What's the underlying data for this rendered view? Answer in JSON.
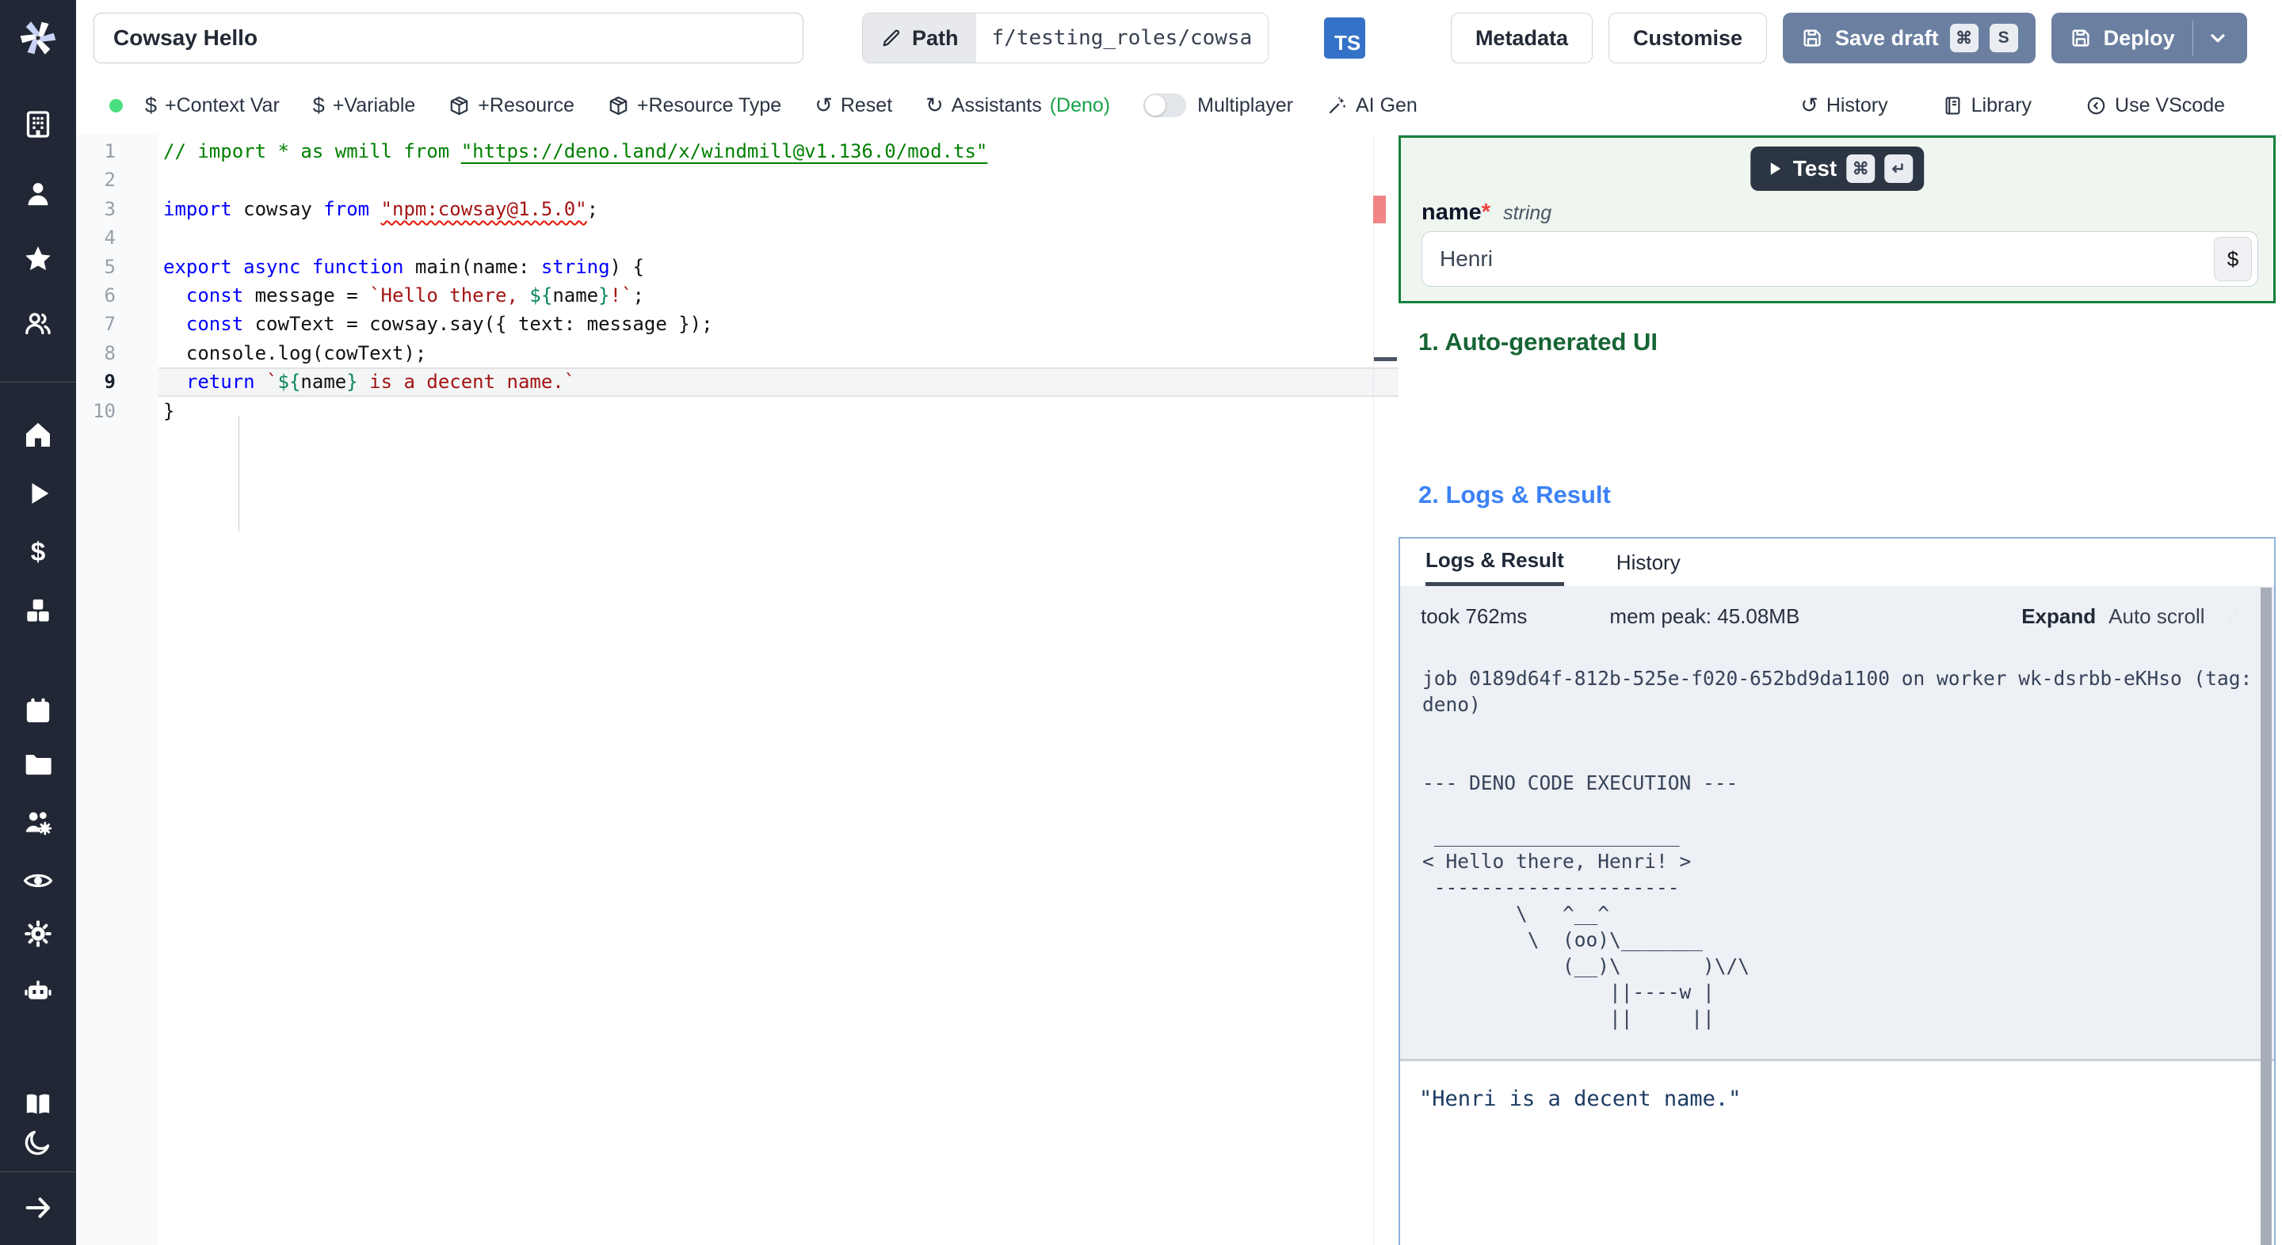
{
  "colors": {
    "sidebar_bg": "#212734",
    "accent_button": "#6b80a1",
    "ts_badge": "#3472c7",
    "status_dot": "#4ade80",
    "deno_green": "#16a34a",
    "section1_green": "#166534",
    "section2_blue": "#3b82f6",
    "test_border_green": "#15803d",
    "logs_border_blue": "#8cb3da",
    "error_marker": "#f18585"
  },
  "sidebar": {
    "logo": "windmill-logo",
    "icons": [
      "building-icon",
      "user-icon",
      "star-icon",
      "users-icon",
      "home-icon",
      "play-icon",
      "dollar-icon",
      "cubes-icon",
      "calendar-icon",
      "folder-icon",
      "users-gear-icon",
      "eye-icon",
      "gear-icon",
      "robot-icon",
      "book-icon",
      "moon-icon",
      "arrow-right-icon"
    ]
  },
  "topbar": {
    "title_value": "Cowsay Hello",
    "path_label": "Path",
    "path_value": "f/testing_roles/cowsa",
    "lang_badge": "TS",
    "metadata_label": "Metadata",
    "customise_label": "Customise",
    "save_draft_label": "Save draft",
    "save_draft_kbd": [
      "⌘",
      "S"
    ],
    "deploy_label": "Deploy"
  },
  "toolbar": {
    "items": [
      {
        "icon": "dollar-icon",
        "label": "+Context Var"
      },
      {
        "icon": "dollar-icon",
        "label": "+Variable"
      },
      {
        "icon": "package-icon",
        "label": "+Resource"
      },
      {
        "icon": "package-icon",
        "label": "+Resource Type"
      },
      {
        "icon": "rotate-ccw-icon",
        "label": "Reset"
      },
      {
        "icon": "refresh-icon",
        "label": "Assistants ",
        "suffix": "(Deno)"
      }
    ],
    "multiplayer_label": "Multiplayer",
    "ai_gen_label": "AI Gen",
    "right_items": [
      {
        "icon": "history-icon",
        "label": "History"
      },
      {
        "icon": "library-icon",
        "label": "Library"
      },
      {
        "icon": "vscode-icon",
        "label": "Use VScode"
      }
    ]
  },
  "editor": {
    "lines": [
      {
        "n": "1",
        "seg": [
          [
            "// import * as wmill from ",
            "comment"
          ],
          [
            "\"https://deno.land/x/windmill@v1.136.0/mod.ts\"",
            "comment link"
          ]
        ]
      },
      {
        "n": "2",
        "seg": []
      },
      {
        "n": "3",
        "seg": [
          [
            "import",
            "kw"
          ],
          [
            " cowsay ",
            "pl"
          ],
          [
            "from",
            "kw"
          ],
          [
            " ",
            "pl"
          ],
          [
            "\"npm:cowsay@1.5.0\"",
            "str sq"
          ],
          [
            ";",
            "pl"
          ]
        ]
      },
      {
        "n": "4",
        "seg": []
      },
      {
        "n": "5",
        "seg": [
          [
            "export",
            "kw"
          ],
          [
            " ",
            "pl"
          ],
          [
            "async",
            "kw"
          ],
          [
            " ",
            "pl"
          ],
          [
            "function",
            "kw"
          ],
          [
            " main(name: ",
            "pl"
          ],
          [
            "string",
            "kw"
          ],
          [
            ") {",
            "pl"
          ]
        ]
      },
      {
        "n": "6",
        "seg": [
          [
            "  ",
            "pl"
          ],
          [
            "const",
            "kw"
          ],
          [
            " message = ",
            "pl"
          ],
          [
            "`Hello there, ",
            "str"
          ],
          [
            "${",
            "interp"
          ],
          [
            "name",
            "pl"
          ],
          [
            "}",
            "interp"
          ],
          [
            "!`",
            "str"
          ],
          [
            ";",
            "pl"
          ]
        ]
      },
      {
        "n": "7",
        "seg": [
          [
            "  ",
            "pl"
          ],
          [
            "const",
            "kw"
          ],
          [
            " cowText = cowsay.say({ text: message });",
            "pl"
          ]
        ]
      },
      {
        "n": "8",
        "seg": [
          [
            "  console.log(cowText);",
            "pl"
          ]
        ]
      },
      {
        "n": "9",
        "active": true,
        "seg": [
          [
            "  ",
            "pl"
          ],
          [
            "return",
            "kw"
          ],
          [
            " ",
            "pl"
          ],
          [
            "`",
            "str"
          ],
          [
            "${",
            "interp"
          ],
          [
            "name",
            "pl"
          ],
          [
            "}",
            "interp"
          ],
          [
            " is a decent name.`",
            "str"
          ]
        ]
      },
      {
        "n": "10",
        "seg": [
          [
            "}",
            "pl"
          ]
        ]
      }
    ]
  },
  "run_panel": {
    "test_label": "Test",
    "test_kbd": [
      "⌘",
      "↵"
    ],
    "field_label": "name",
    "required_mark": "*",
    "field_type": "string",
    "field_value": "Henri",
    "dollar_btn": "$"
  },
  "sections": {
    "s1": "1. Auto-generated UI",
    "s2": "2. Logs & Result"
  },
  "logs_panel": {
    "tabs": [
      {
        "label": "Logs & Result",
        "active": true
      },
      {
        "label": "History",
        "active": false
      }
    ],
    "meta": {
      "took": "took 762ms",
      "mem": "mem peak: 45.08MB",
      "expand": "Expand",
      "autoscroll": "Auto scroll",
      "check": "✓"
    },
    "log_text": "job 0189d64f-812b-525e-f020-652bd9da1100 on worker wk-dsrbb-eKHso (tag:\ndeno)\n\n\n--- DENO CODE EXECUTION ---\n\n _____________________\n< Hello there, Henri! >\n ---------------------\n        \\   ^__^\n         \\  (oo)\\_______\n            (__)\\       )\\/\\\n                ||----w |\n                ||     ||",
    "result_text": "\"Henri is a decent name.\""
  }
}
